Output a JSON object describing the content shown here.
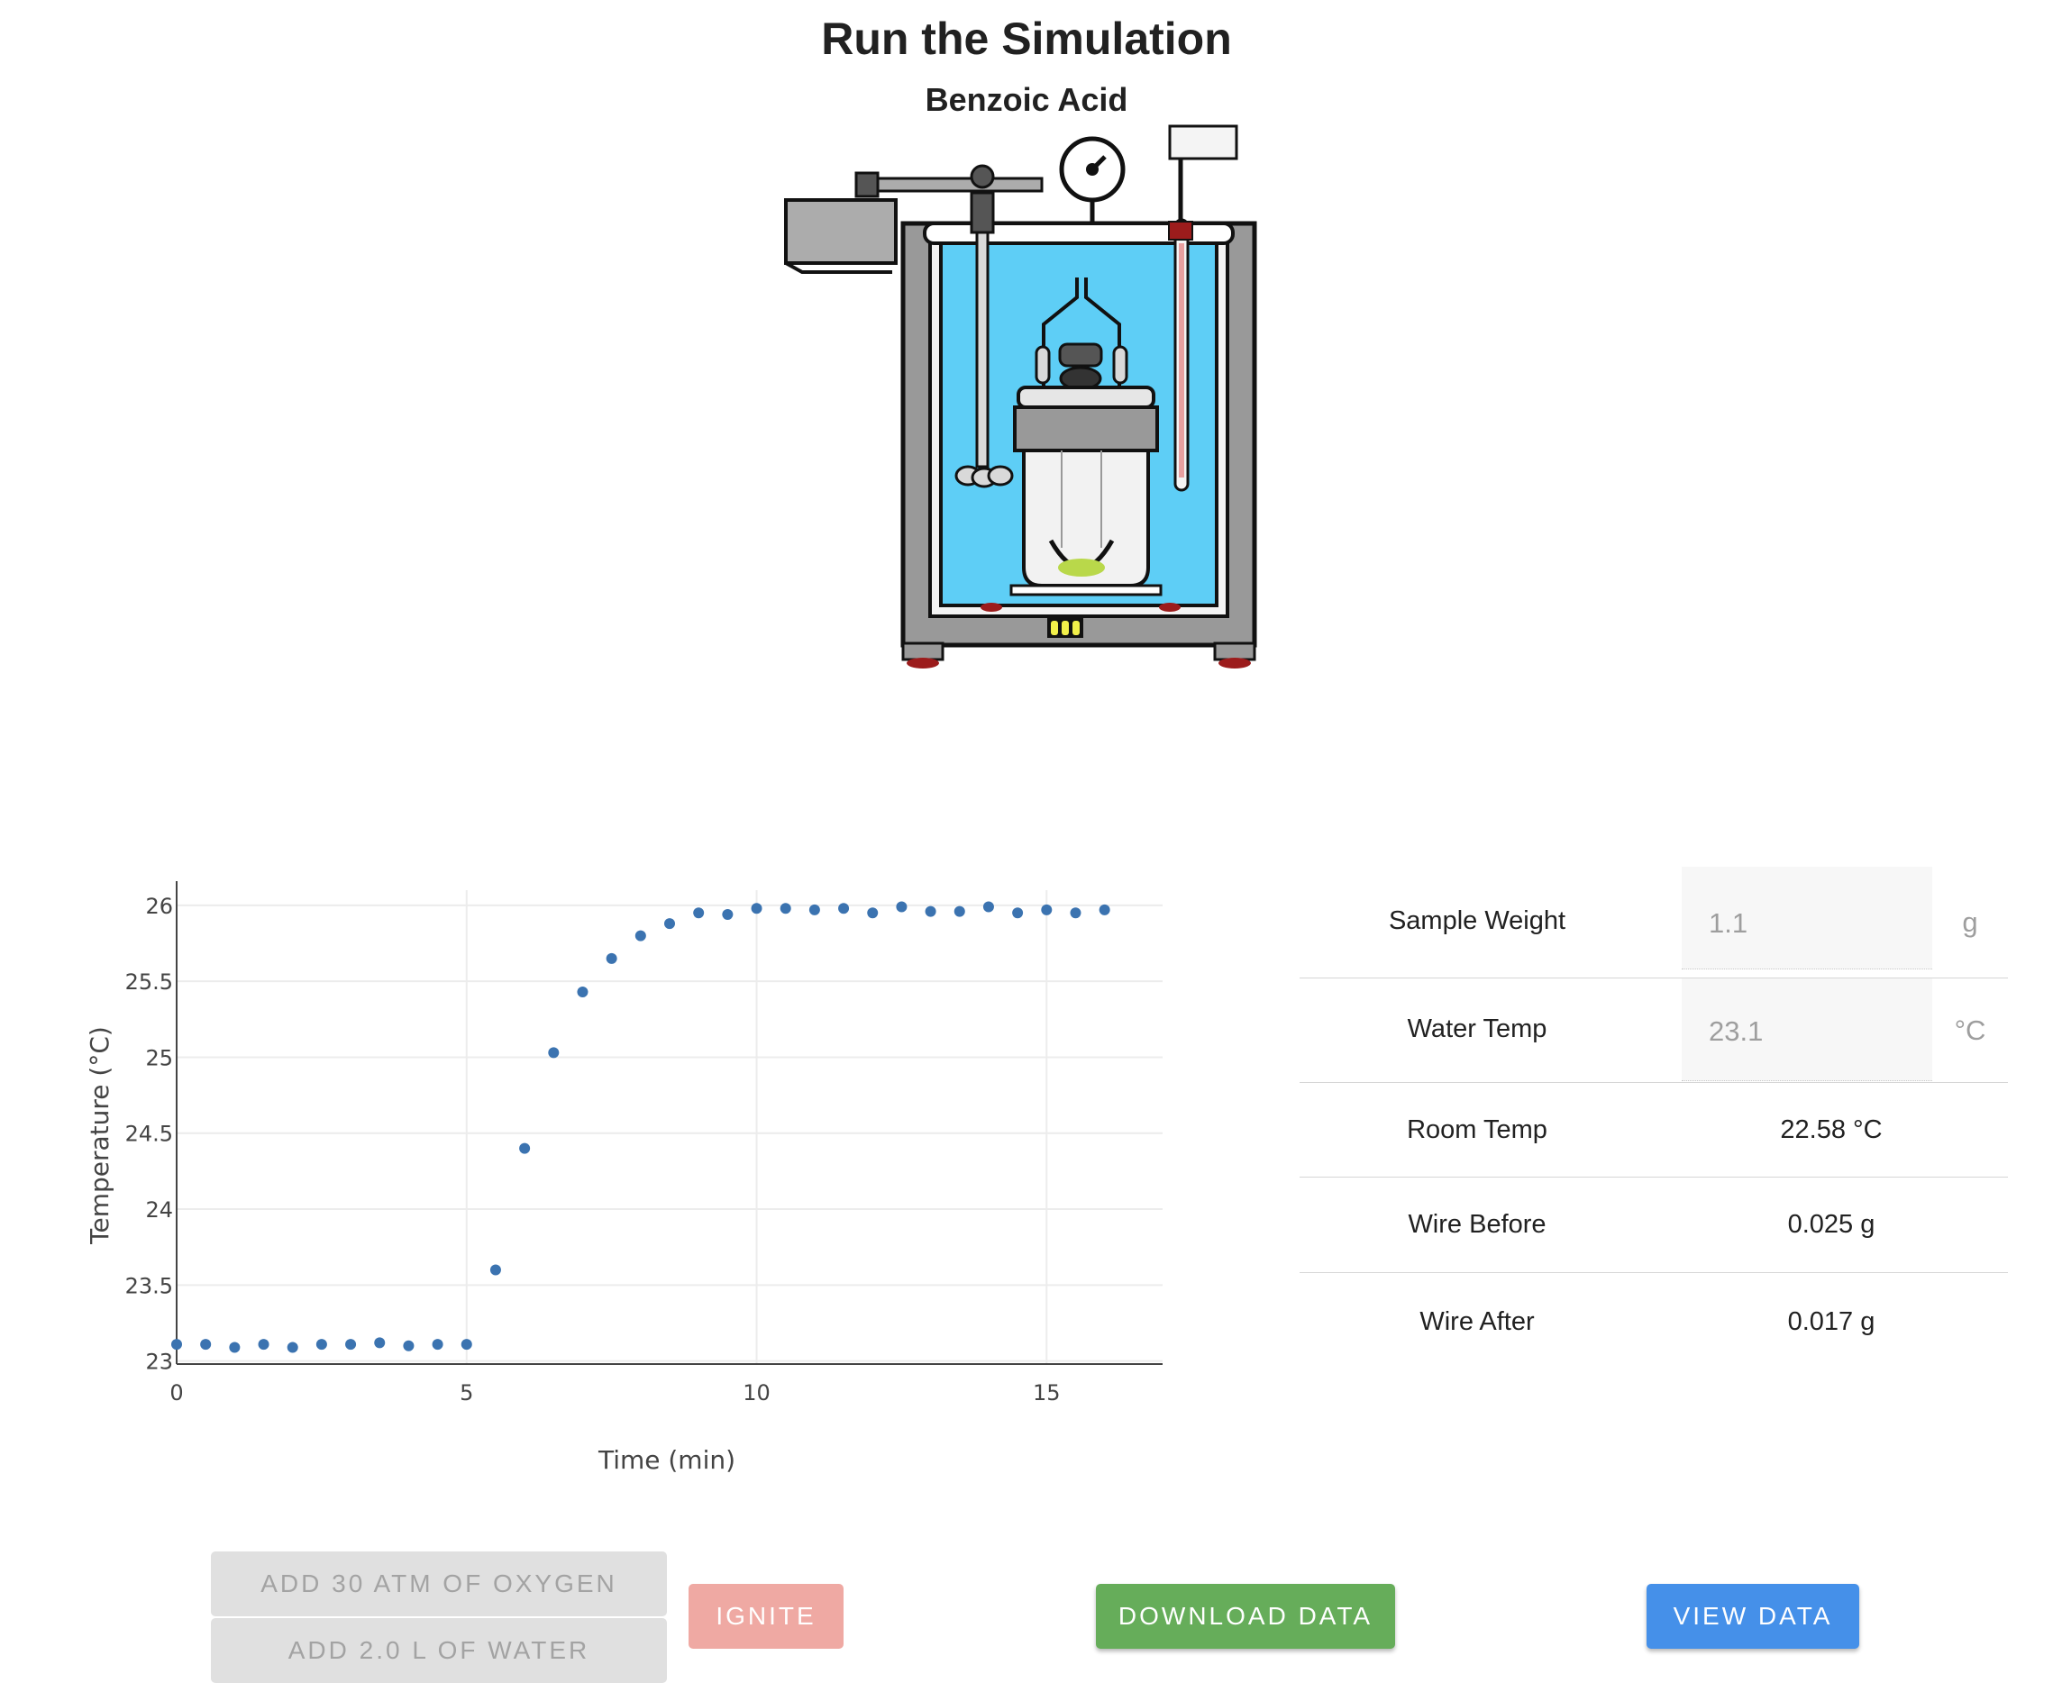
{
  "header": {
    "title": "Run the Simulation",
    "subtitle": "Benzoic Acid"
  },
  "colors": {
    "water": "#5ecef6",
    "sample": "#b9d84a",
    "marker": "#3b73b0",
    "ignite_button": "#efa9a3",
    "download_button": "#66ad5a",
    "view_button": "#4590e9",
    "disabled_button": "#e0e0e0"
  },
  "chart_data": {
    "type": "scatter",
    "xlabel": "Time (min)",
    "ylabel": "Temperature (°C)",
    "xlim": [
      0,
      17
    ],
    "ylim": [
      22.98,
      26.1
    ],
    "x_ticks": [
      0,
      5,
      10,
      15
    ],
    "y_ticks": [
      23,
      23.5,
      24,
      24.5,
      25,
      25.5,
      26
    ],
    "x_tick_labels": [
      "0",
      "5",
      "10",
      "15"
    ],
    "y_tick_labels": [
      "23",
      "23.5",
      "24",
      "24.5",
      "25",
      "25.5",
      "26"
    ],
    "grid": true,
    "legend": "none",
    "points": [
      [
        0,
        23.11
      ],
      [
        0.5,
        23.11
      ],
      [
        1,
        23.09
      ],
      [
        1.5,
        23.11
      ],
      [
        2,
        23.09
      ],
      [
        2.5,
        23.11
      ],
      [
        3,
        23.11
      ],
      [
        3.5,
        23.12
      ],
      [
        4,
        23.1
      ],
      [
        4.5,
        23.11
      ],
      [
        5,
        23.11
      ],
      [
        5.5,
        23.6
      ],
      [
        6,
        24.4
      ],
      [
        6.5,
        25.03
      ],
      [
        7,
        25.43
      ],
      [
        7.5,
        25.65
      ],
      [
        8,
        25.8
      ],
      [
        8.5,
        25.88
      ],
      [
        9,
        25.95
      ],
      [
        9.5,
        25.94
      ],
      [
        10,
        25.98
      ],
      [
        10.5,
        25.98
      ],
      [
        11,
        25.97
      ],
      [
        11.5,
        25.98
      ],
      [
        12,
        25.95
      ],
      [
        12.5,
        25.99
      ],
      [
        13,
        25.96
      ],
      [
        13.5,
        25.96
      ],
      [
        14,
        25.99
      ],
      [
        14.5,
        25.95
      ],
      [
        15,
        25.97
      ],
      [
        15.5,
        25.95
      ],
      [
        16,
        25.97
      ]
    ]
  },
  "table": {
    "sample_weight": {
      "label": "Sample Weight",
      "value": "1.1",
      "unit": "g"
    },
    "water_temp": {
      "label": "Water Temp",
      "value": "23.1",
      "unit": "°C"
    },
    "room_temp": {
      "label": "Room Temp",
      "value": "22.58 °C"
    },
    "wire_before": {
      "label": "Wire Before",
      "value": "0.025 g"
    },
    "wire_after": {
      "label": "Wire After",
      "value": "0.017 g"
    }
  },
  "buttons": {
    "add_oxygen": "ADD 30 ATM OF OXYGEN",
    "add_water": "ADD 2.0 L OF WATER",
    "ignite": "IGNITE",
    "download": "DOWNLOAD DATA",
    "view": "VIEW DATA"
  }
}
